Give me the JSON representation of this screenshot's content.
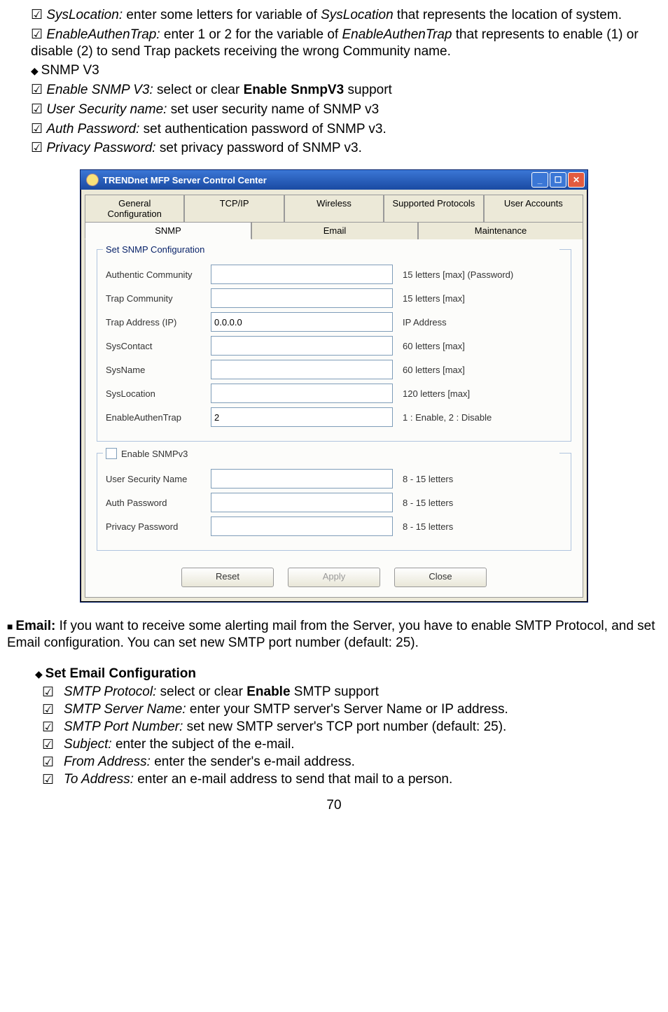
{
  "doc": {
    "syslocation_label": "SysLocation:",
    "syslocation_text": " enter some letters for variable of ",
    "syslocation_var": "SysLocation",
    "syslocation_tail": " that represents the location of system.",
    "enableauthen_label": "EnableAuthenTrap:",
    "enableauthen_text": " enter 1 or 2 for the variable of ",
    "enableauthen_var": "EnableAuthenTrap",
    "enableauthen_tail": " that represents to enable (1) or disable (2) to send Trap packets receiving the wrong Community name.",
    "snmpv3_heading": "SNMP V3",
    "enable_snmpv3_label": "Enable SNMP V3:",
    "enable_snmpv3_text": " select or clear ",
    "enable_snmpv3_bold": "Enable SnmpV3",
    "enable_snmpv3_tail": " support",
    "usersec_label": "User Security name:",
    "usersec_text": " set user security name of SNMP v3",
    "authpw_label": "Auth Password:",
    "authpw_text": " set authentication password of SNMP v3.",
    "privpw_label": "Privacy Password:",
    "privpw_text": " set privacy password of SNMP v3.",
    "email_bold": "Email:",
    "email_text": " If you want to receive some alerting mail from the Server, you have to enable SMTP Protocol, and set Email configuration. You can set new SMTP port number (default: 25).",
    "set_email_heading": "Set Email Configuration",
    "smtp_proto_label": "SMTP Protocol:",
    "smtp_proto_text": " select or clear ",
    "smtp_proto_bold": "Enable",
    "smtp_proto_tail": " SMTP support",
    "smtp_server_label": "SMTP Server Name:",
    "smtp_server_text": " enter your SMTP server's Server Name or IP address.",
    "smtp_port_label": "SMTP Port Number:",
    "smtp_port_text": " set new SMTP server's TCP port number (default: 25).",
    "subject_label": "Subject:",
    "subject_text": " enter the subject of the e-mail.",
    "from_label": "From Address:",
    "from_text": " enter the sender's e-mail address.",
    "to_label": "To Address:",
    "to_text": " enter an e-mail address to send that mail to a person.",
    "page_number": "70"
  },
  "window": {
    "title": "TRENDnet MFP Server Control Center",
    "tabs_row1": [
      "General Configuration",
      "TCP/IP",
      "Wireless",
      "Supported Protocols",
      "User Accounts"
    ],
    "tabs_row2": [
      "SNMP",
      "Email",
      "Maintenance"
    ],
    "fieldset1_legend": "Set SNMP Configuration",
    "rows1": [
      {
        "label": "Authentic Community",
        "value": "",
        "hint": "15 letters [max] (Password)"
      },
      {
        "label": "Trap Community",
        "value": "",
        "hint": "15 letters [max]"
      },
      {
        "label": "Trap Address (IP)",
        "value": "0.0.0.0",
        "hint": "IP Address"
      },
      {
        "label": "SysContact",
        "value": "",
        "hint": "60 letters [max]"
      },
      {
        "label": "SysName",
        "value": "",
        "hint": "60 letters [max]"
      },
      {
        "label": "SysLocation",
        "value": "",
        "hint": "120 letters [max]"
      },
      {
        "label": "EnableAuthenTrap",
        "value": "2",
        "hint": "1 : Enable, 2 : Disable"
      }
    ],
    "snmpv3_checkbox_label": "Enable SNMPv3",
    "rows2": [
      {
        "label": "User Security Name",
        "value": "",
        "hint": "8 - 15 letters"
      },
      {
        "label": "Auth Password",
        "value": "",
        "hint": "8 - 15 letters"
      },
      {
        "label": "Privacy Password",
        "value": "",
        "hint": "8 - 15 letters"
      }
    ],
    "buttons": {
      "reset": "Reset",
      "apply": "Apply",
      "close": "Close"
    }
  }
}
